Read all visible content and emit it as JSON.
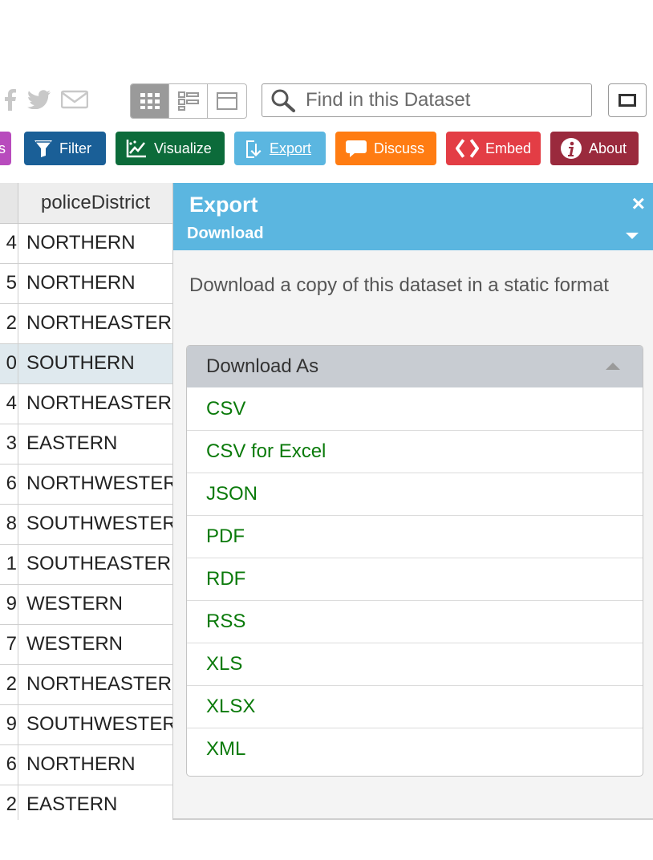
{
  "search": {
    "placeholder": "Find in this Dataset"
  },
  "toolbar": {
    "buttons": [
      {
        "label": "s",
        "color": "#b84bbd"
      },
      {
        "label": "Filter",
        "color": "#1a5f97"
      },
      {
        "label": "Visualize",
        "color": "#0c6b3a"
      },
      {
        "label": "Export",
        "color": "#5bb6e0"
      },
      {
        "label": "Discuss",
        "color": "#ff7c12"
      },
      {
        "label": "Embed",
        "color": "#e33d45"
      },
      {
        "label": "About",
        "color": "#9a2a3d"
      }
    ]
  },
  "table": {
    "column_header": "policeDistrict",
    "rows": [
      {
        "a": "4",
        "b": "NORTHERN"
      },
      {
        "a": "5",
        "b": "NORTHERN"
      },
      {
        "a": "2",
        "b": "NORTHEASTERN"
      },
      {
        "a": "0",
        "b": "SOUTHERN"
      },
      {
        "a": "4",
        "b": "NORTHEASTERN"
      },
      {
        "a": "3",
        "b": "EASTERN"
      },
      {
        "a": "6",
        "b": "NORTHWESTERN"
      },
      {
        "a": "8",
        "b": "SOUTHWESTERN"
      },
      {
        "a": "1",
        "b": "SOUTHEASTERN"
      },
      {
        "a": "9",
        "b": "WESTERN"
      },
      {
        "a": "7",
        "b": "WESTERN"
      },
      {
        "a": "2",
        "b": "NORTHEASTERN"
      },
      {
        "a": "9",
        "b": "SOUTHWESTERN"
      },
      {
        "a": "6",
        "b": "NORTHERN"
      },
      {
        "a": "2",
        "b": "EASTERN"
      }
    ]
  },
  "export_panel": {
    "title": "Export",
    "close": "×",
    "subtitle": "Download",
    "description": "Download a copy of this dataset in a static format",
    "download_as": "Download As",
    "formats": [
      "CSV",
      "CSV for Excel",
      "JSON",
      "PDF",
      "RDF",
      "RSS",
      "XLS",
      "XLSX",
      "XML"
    ]
  }
}
